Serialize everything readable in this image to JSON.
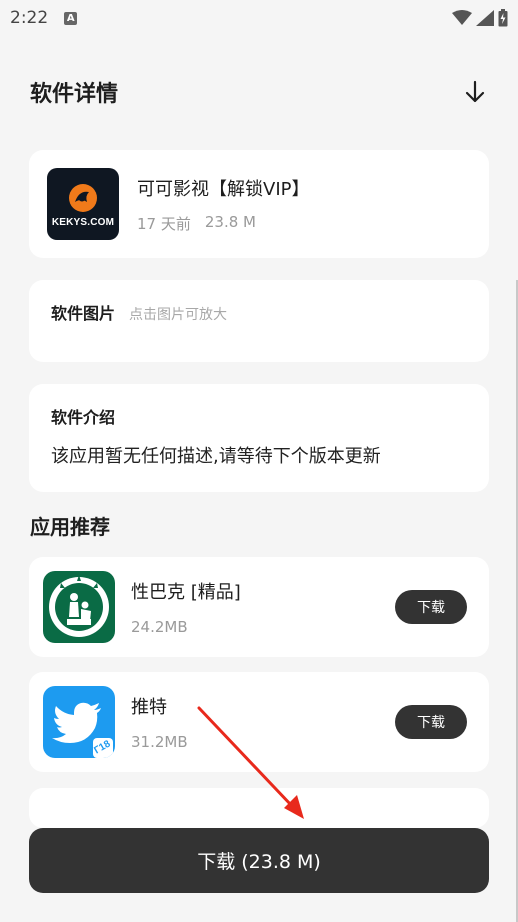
{
  "status_bar": {
    "time": "2:22",
    "notification_badge": "A"
  },
  "header": {
    "title": "软件详情",
    "download_icon": "arrow-down-icon"
  },
  "app": {
    "name": "可可影视【解锁VIP】",
    "age": "17 天前",
    "size": "23.8 M",
    "logo_text": "KEKYS.COM",
    "logo_accent": "#f07a1a"
  },
  "images_section": {
    "label": "软件图片",
    "hint": "点击图片可放大"
  },
  "intro_section": {
    "label": "软件介绍",
    "text": "该应用暂无任何描述,请等待下个版本更新"
  },
  "recommend": {
    "heading": "应用推荐",
    "items": [
      {
        "name": "性巴克 [精品]",
        "size": "24.2MB",
        "button": "下载",
        "icon": "starbucks-parody-icon",
        "icon_color": "#0a6b45"
      },
      {
        "name": "推特",
        "size": "31.2MB",
        "button": "下载",
        "icon": "twitter-bird-icon",
        "icon_color": "#1d9bf0",
        "icon_badge": "Г18"
      }
    ]
  },
  "bottom_button": {
    "label": "下载 (23.8 M)"
  },
  "colors": {
    "button_dark": "#333333",
    "background": "#f5f5f5",
    "card": "#ffffff",
    "annotation_red": "#e8291c"
  }
}
